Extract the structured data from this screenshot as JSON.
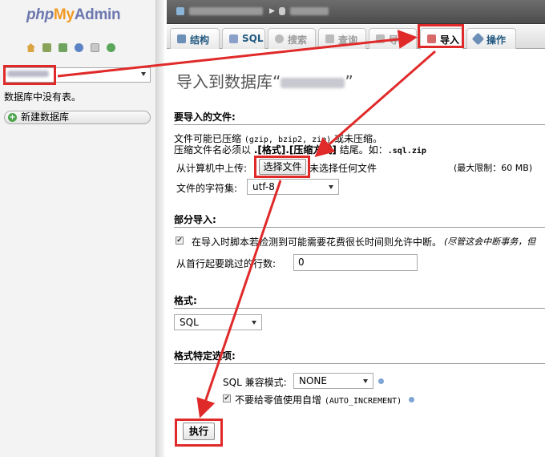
{
  "sidebar": {
    "logo": {
      "php": "php",
      "my": "My",
      "admin": "Admin"
    },
    "icons": [
      "home-icon",
      "database-icon",
      "exit-icon",
      "help-icon",
      "docs-icon",
      "reload-icon"
    ],
    "db_select_value": "test0006",
    "no_tables_text": "数据库中没有表。",
    "new_db_label": "新建数据库"
  },
  "topbar": {
    "server": "116.255.107.2",
    "database": "test0006"
  },
  "tabs": [
    {
      "label": "结构",
      "icon": "structure-icon"
    },
    {
      "label": "SQL",
      "icon": "sql-icon"
    },
    {
      "label": "搜索",
      "icon": "search-icon"
    },
    {
      "label": "查询",
      "icon": "query-icon"
    },
    {
      "label": "导",
      "icon": "export-icon"
    },
    {
      "label": "导入",
      "icon": "import-icon"
    },
    {
      "label": "操作",
      "icon": "operations-icon"
    }
  ],
  "main": {
    "title_prefix": "导入到数据库“",
    "title_db": "test0006",
    "title_suffix": "”",
    "file_section": {
      "heading": "要导入的文件:",
      "line1_a": "文件可能已压缩 ",
      "line1_b": "(gzip, bzip2, zip)",
      "line1_c": " 或未压缩。",
      "line2_a": "压缩文件名必须以 ",
      "line2_b": ".[格式].[压缩方式]",
      "line2_c": " 结尾。如：",
      "line2_d": ".sql.zip",
      "upload_label": "从计算机中上传:",
      "choose_button": "选择文件",
      "no_file_text": "未选择任何文件",
      "max_limit": "(最大限制：60 MB)",
      "charset_label": "文件的字符集:",
      "charset_value": "utf-8"
    },
    "partial_section": {
      "heading": "部分导入:",
      "allow_interrupt_text": "在导入时脚本若检测到可能需要花费很长时间则允许中断。",
      "allow_interrupt_note": "(尽管这会中断事务，但",
      "allow_interrupt_checked": true,
      "skip_label": "从首行起要跳过的行数:",
      "skip_value": "0"
    },
    "format_section": {
      "heading": "格式:",
      "format_value": "SQL"
    },
    "format_options_section": {
      "heading": "格式特定选项:",
      "compat_label": "SQL 兼容模式:",
      "compat_value": "NONE",
      "no_auto_value_text_a": "不要给零值使用自增",
      "no_auto_value_text_b": "(AUTO_INCREMENT)",
      "no_auto_value_checked": true
    },
    "go_button": "执行"
  },
  "annotations": {
    "color": "#e02a2a"
  }
}
